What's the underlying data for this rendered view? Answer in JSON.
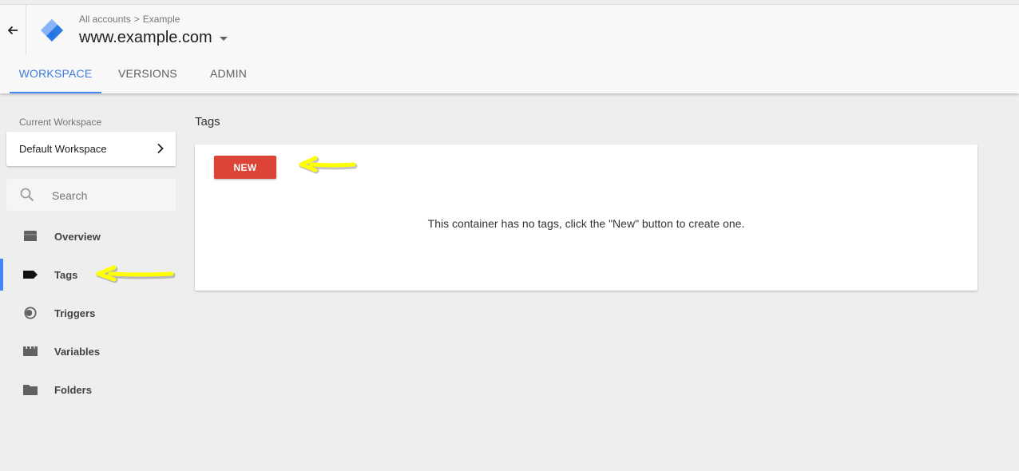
{
  "header": {
    "breadcrumb": {
      "root": "All accounts",
      "separator": ">",
      "account": "Example"
    },
    "container_name": "www.example.com"
  },
  "tabs": [
    {
      "label": "WORKSPACE",
      "active": true
    },
    {
      "label": "VERSIONS",
      "active": false
    },
    {
      "label": "ADMIN",
      "active": false
    }
  ],
  "sidebar": {
    "current_workspace_label": "Current Workspace",
    "workspace_name": "Default Workspace",
    "search_placeholder": "Search",
    "items": [
      {
        "label": "Overview",
        "icon": "overview-icon",
        "active": false
      },
      {
        "label": "Tags",
        "icon": "tag-icon",
        "active": true
      },
      {
        "label": "Triggers",
        "icon": "trigger-icon",
        "active": false
      },
      {
        "label": "Variables",
        "icon": "variables-icon",
        "active": false
      },
      {
        "label": "Folders",
        "icon": "folder-icon",
        "active": false
      }
    ]
  },
  "main": {
    "title": "Tags",
    "new_button_label": "NEW",
    "empty_message": "This container has no tags, click the \"New\" button to create one."
  },
  "colors": {
    "accent_blue": "#4285f4",
    "new_button_red": "#db4437",
    "annotation_yellow": "#ffff00"
  }
}
